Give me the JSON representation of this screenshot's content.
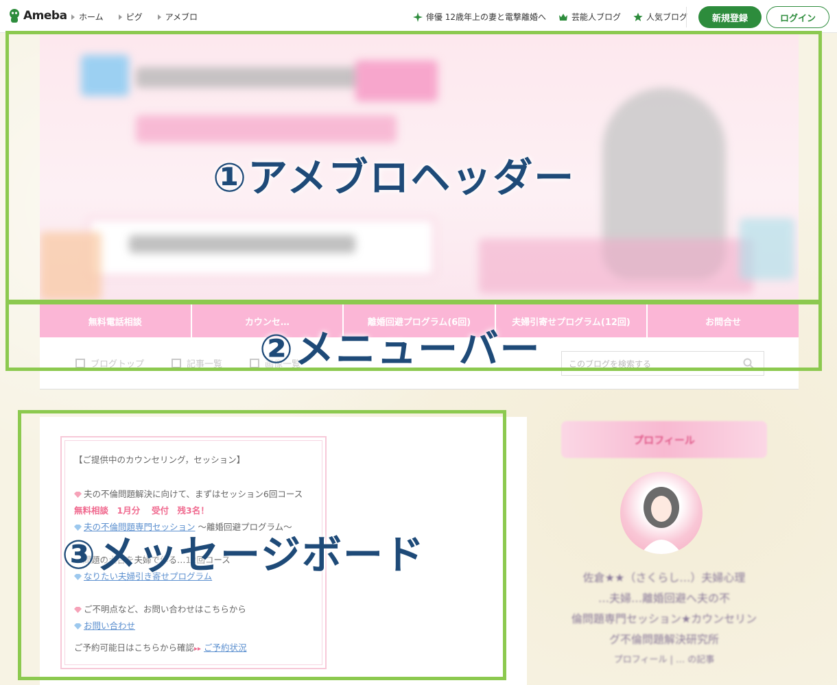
{
  "topbar": {
    "logo_text": "Ameba",
    "crumbs": [
      "ホーム",
      "ピグ",
      "アメブロ"
    ],
    "right_links": [
      "俳優 12歳年上の妻と電撃離婚へ",
      "芸能人ブログ",
      "人気ブログ"
    ],
    "register_label": "新規登録",
    "login_label": "ログイン",
    "brand_color": "#2d8c3c"
  },
  "menu": {
    "items": [
      "無料電話相談",
      "カウンセ…",
      "離婚回避プログラム(6回)",
      "夫婦引寄せプログラム(12回)",
      "お問合せ"
    ],
    "color": "#fbb6d6"
  },
  "subnav": {
    "items": [
      "ブログトップ",
      "記事一覧",
      "画像一覧"
    ],
    "search_placeholder": "このブログを検索する"
  },
  "message_board": {
    "lines": [
      "【ご提供中のカウンセリング，セッション】",
      "夫の不倫問題解決に向けて、まずはセッション6回コース",
      "無料相談　1月分　 受付　残3名！",
      "夫の不倫問題専門セッション",
      "〜離婚回避プログラム〜",
      "…問題の土台を夫婦で作る…12回コース",
      "なりたい夫婦引き寄せプログラム",
      "ご不明点など、お問い合わせはこちらから",
      "お問い合わせ",
      "ご予約可能日はこちらから確認",
      "ご予約状況"
    ]
  },
  "sidebar": {
    "banner_label": "プロフィール",
    "profile_lines": [
      "佐倉★★（さくらし…）夫婦心理",
      "…夫婦…離婚回避へ夫の不",
      "倫問題専門セッション★カウンセリン",
      "グ不倫問題解決研究所",
      "プロフィール | … の記事"
    ]
  },
  "annotations": [
    {
      "label": "①アメブロヘッダー"
    },
    {
      "label": "②メニューバー"
    },
    {
      "label": "③メッセージボード"
    }
  ],
  "annotation_color": "#8cc94f"
}
